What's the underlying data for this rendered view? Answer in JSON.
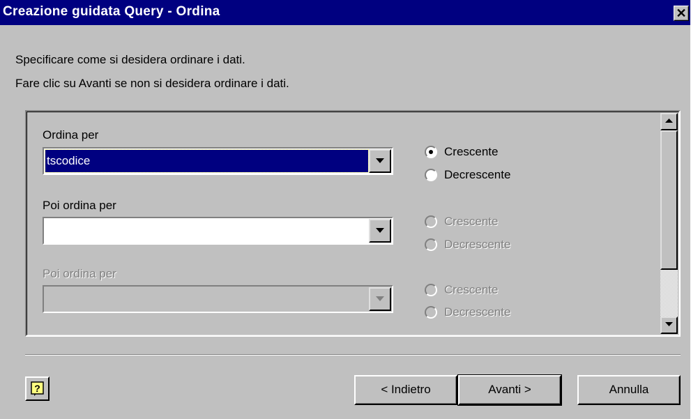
{
  "window": {
    "title": "Creazione guidata Query - Ordina",
    "close_glyph": "✕"
  },
  "instructions": {
    "line1": "Specificare come si desidera ordinare i dati.",
    "line2": "Fare clic su Avanti se non si desidera ordinare i dati."
  },
  "sort_groups": [
    {
      "label": "Ordina per",
      "field_value": "tscodice",
      "enabled": true,
      "options": {
        "asc": "Crescente",
        "desc": "Decrescente",
        "selected": "asc"
      }
    },
    {
      "label": "Poi ordina per",
      "field_value": "",
      "enabled": true,
      "options": {
        "asc": "Crescente",
        "desc": "Decrescente",
        "selected": "none"
      }
    },
    {
      "label": "Poi ordina per",
      "field_value": "",
      "enabled": false,
      "options": {
        "asc": "Crescente",
        "desc": "Decrescente",
        "selected": "none"
      }
    }
  ],
  "buttons": {
    "back": "< Indietro",
    "next": "Avanti >",
    "cancel": "Annulla",
    "help_icon": "help-icon"
  },
  "colors": {
    "titlebar": "#000080",
    "face": "#c0c0c0",
    "selection": "#000080"
  }
}
